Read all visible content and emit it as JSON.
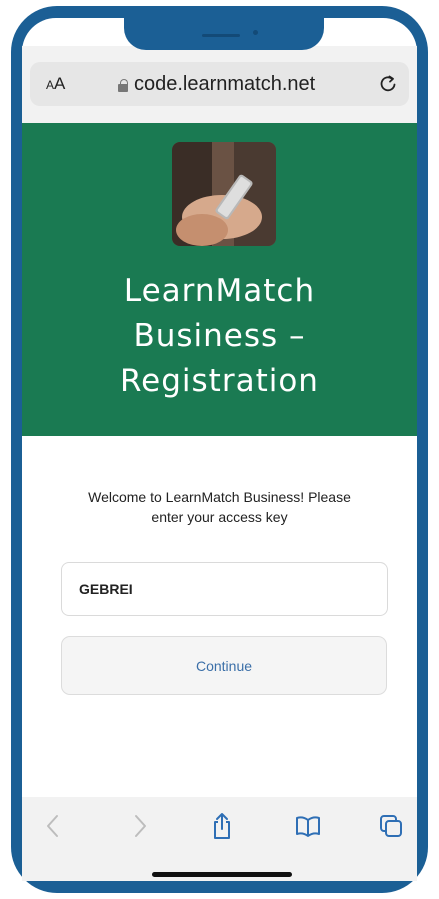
{
  "browser": {
    "text_size_small": "A",
    "text_size_large": "A",
    "url": "code.learnmatch.net"
  },
  "hero": {
    "title_line1": "LearnMatch",
    "title_line2": "Business –",
    "title_line3": "Registration"
  },
  "form": {
    "welcome_line1": "Welcome to LearnMatch Business! Please",
    "welcome_line2": "enter your access key",
    "access_key_value": "GEBREI",
    "continue_label": "Continue"
  },
  "colors": {
    "frame": "#1b5f95",
    "hero_bg": "#1a7a52",
    "link_blue": "#3b6fa8"
  },
  "icons": [
    "lock-icon",
    "reload-icon",
    "back-icon",
    "forward-icon",
    "share-icon",
    "bookmarks-icon",
    "tabs-icon"
  ]
}
